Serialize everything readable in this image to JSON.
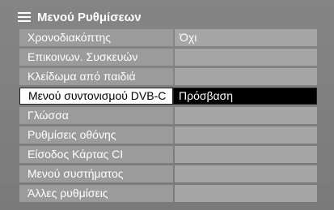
{
  "title": "Μενού Ρυθμίσεων",
  "rows": [
    {
      "label": "Χρονοδιακόπτης",
      "value": "Όχι"
    },
    {
      "label": "Επικοινων. Συσκευών",
      "value": ""
    },
    {
      "label": "Κλείδωμα από παιδιά",
      "value": ""
    },
    {
      "label": "Μενού συντονισμού DVB-C",
      "value": "Πρόσβαση"
    },
    {
      "label": "Γλώσσα",
      "value": ""
    },
    {
      "label": "Ρυθμίσεις οθόνης",
      "value": ""
    },
    {
      "label": "Είσοδος Κάρτας CI",
      "value": ""
    },
    {
      "label": "Μενού συστήματος",
      "value": ""
    },
    {
      "label": "Άλλες ρυθμίσεις",
      "value": ""
    }
  ],
  "selected_index": 3,
  "colors": {
    "panel": "#808080",
    "row": "#9b9b9b",
    "selected_bg": "#000000"
  }
}
